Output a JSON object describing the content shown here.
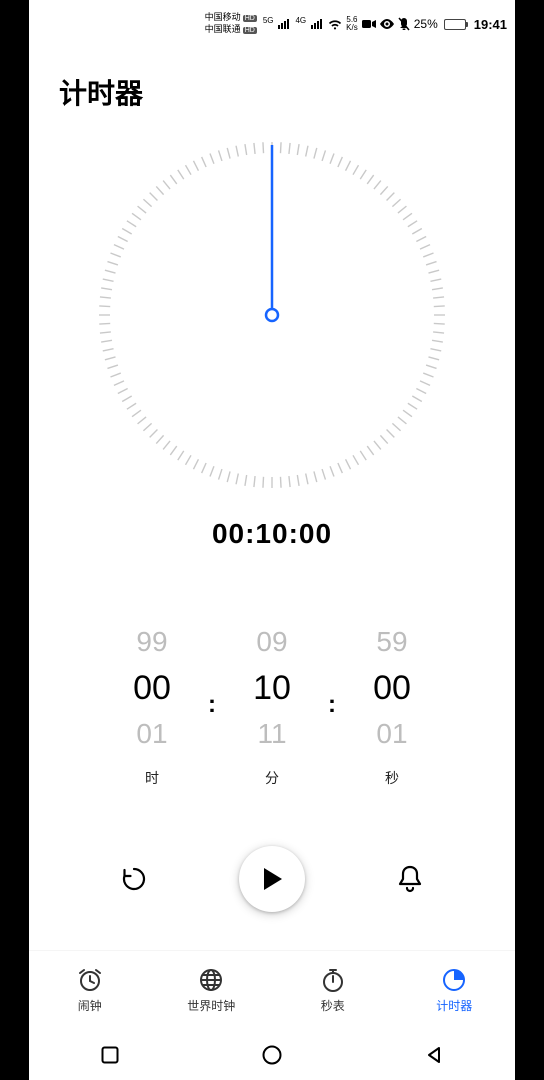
{
  "statusbar": {
    "carrier1": "中国移动",
    "carrier2": "中国联通",
    "hd": "HD",
    "net5g": "5G",
    "net4g": "4G",
    "speed_top": "5.6",
    "speed_bot": "K/s",
    "battery_pct": "25%",
    "time": "19:41"
  },
  "title": "计时器",
  "timer_display": "00:10:00",
  "picker": {
    "hour": {
      "prev": "99",
      "cur": "00",
      "next": "01",
      "label": "时"
    },
    "minute": {
      "prev": "09",
      "cur": "10",
      "next": "11",
      "label": "分"
    },
    "second": {
      "prev": "59",
      "cur": "00",
      "next": "01",
      "label": "秒"
    },
    "colon": ":"
  },
  "nav": {
    "alarm": "闹钟",
    "world": "世界时钟",
    "stopwatch": "秒表",
    "timer": "计时器"
  }
}
